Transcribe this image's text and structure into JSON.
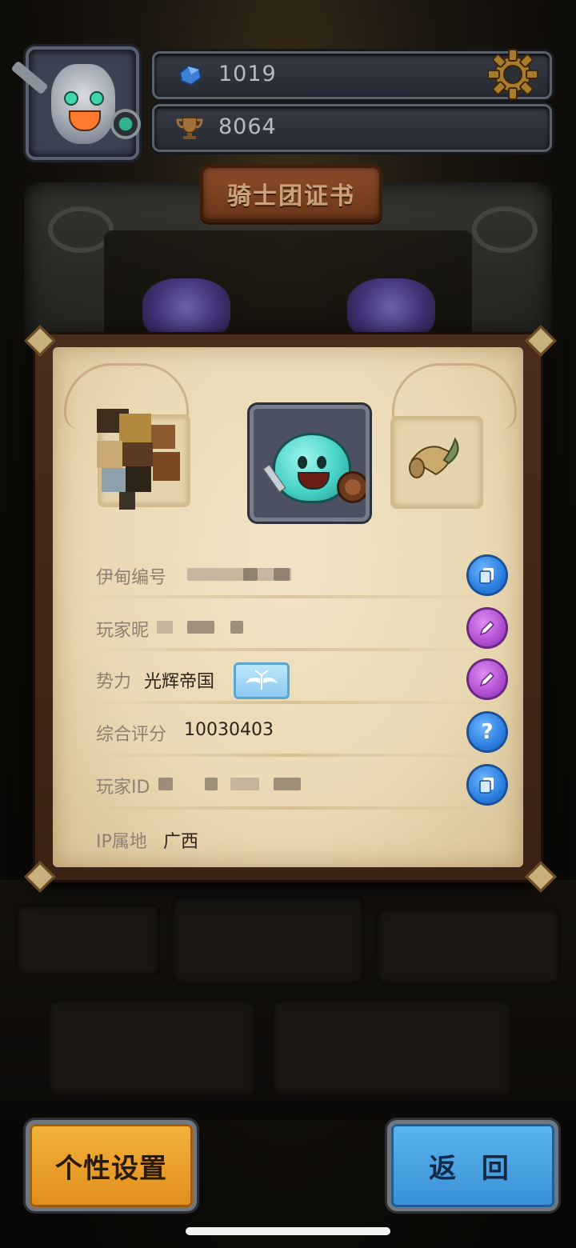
{
  "hud": {
    "gems_value": "1019",
    "trophy_value": "8064",
    "gem_icon": "blue-gem-icon",
    "trophy_icon": "trophy-icon",
    "settings_icon": "gear-icon"
  },
  "title": "骑士团证书",
  "card": {
    "rows": [
      {
        "label": "伊甸编号",
        "value": "",
        "action_icon": "copy-icon"
      },
      {
        "label": "玩家昵",
        "value": "",
        "action_icon": "edit-icon"
      },
      {
        "label": "势力",
        "value": "光辉帝国",
        "action_icon": "edit-icon"
      },
      {
        "label": "综合评分",
        "value": "10030403",
        "action_icon": "help-icon"
      },
      {
        "label": "玩家ID",
        "value": "",
        "action_icon": "copy-icon"
      },
      {
        "label": "IP属地",
        "value": "广西"
      }
    ]
  },
  "buttons": {
    "customize": "个性设置",
    "back": "返 回"
  },
  "colors": {
    "orange_button": "#e9a02a",
    "blue_button": "#4aa3e2",
    "parchment": "#ecdcb8",
    "blue_action": "#2a7fe0",
    "purple_action": "#b14fd3"
  }
}
